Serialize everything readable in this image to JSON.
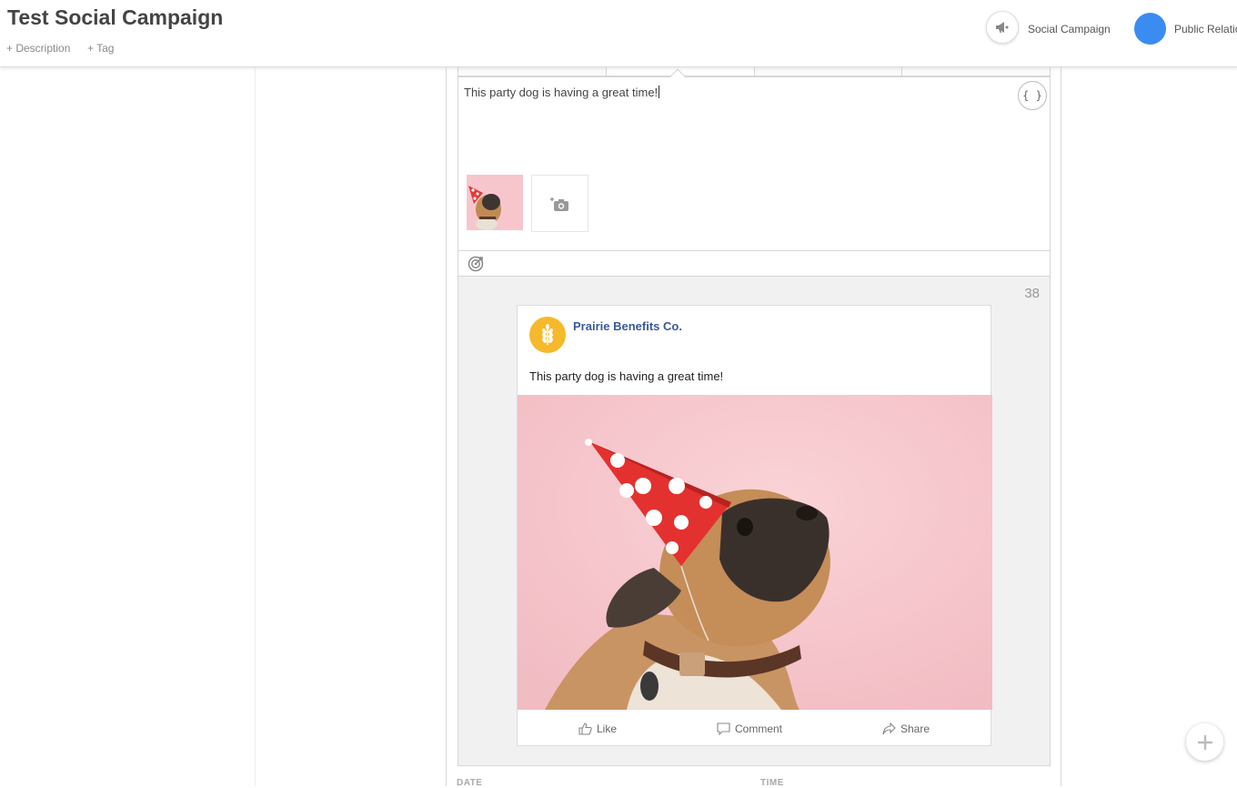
{
  "header": {
    "title": "Test Social Campaign",
    "description_link": "+ Description",
    "tag_link": "+ Tag",
    "campaign_type": "Social Campaign",
    "team": "Public Relations"
  },
  "composer": {
    "text": "This party dog is having a great time!",
    "variable_button": "{ }"
  },
  "preview": {
    "char_count": "38",
    "page_name": "Prairie Benefits Co.",
    "post_text": "This party dog is having a great time!",
    "actions": {
      "like": "Like",
      "comment": "Comment",
      "share": "Share"
    }
  },
  "schedule": {
    "date_label": "DATE",
    "time_label": "TIME"
  },
  "colors": {
    "accent_blue": "#3b8cf0",
    "fb_blue": "#3b5998",
    "brand_yellow": "#f6b92b"
  }
}
